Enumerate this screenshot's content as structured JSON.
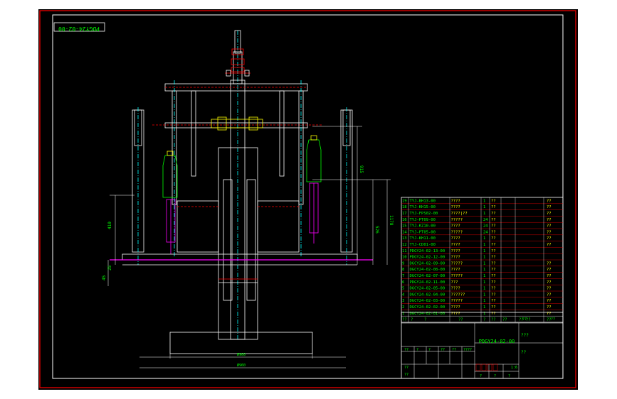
{
  "drawing": {
    "number_label": "PDGY24-02-00",
    "title_block": {
      "drawing_no": "PDGY24-02-00",
      "name_placeholder": "???",
      "material_placeholder": "??",
      "scale": "1:6",
      "header_cells": [
        "??",
        "?",
        "?",
        "??",
        "??",
        "????",
        "??",
        "??"
      ],
      "sheet_cells": [
        "?",
        "?",
        "?"
      ],
      "marks": [
        "??",
        "??"
      ]
    },
    "bom": [
      {
        "no": "19",
        "code": "TYJ-BH13-00",
        "name": "????",
        "qty": "1",
        "mat": "??",
        "note": "??"
      },
      {
        "no": "18",
        "code": "TYJ-KH15-00",
        "name": "????",
        "qty": "1",
        "mat": "??",
        "note": "??"
      },
      {
        "no": "17",
        "code": "TYJ-FPS02-00",
        "name": "????|??",
        "qty": "1",
        "mat": "??",
        "note": "??"
      },
      {
        "no": "16",
        "code": "TYJ-PT09-00",
        "name": "?????",
        "qty": "24",
        "mat": "??",
        "note": "??"
      },
      {
        "no": "15",
        "code": "TYJ-KZ10-00",
        "name": "????",
        "qty": "24",
        "mat": "??",
        "note": "??"
      },
      {
        "no": "14",
        "code": "TYJ-PT05-00",
        "name": "?????",
        "qty": "24",
        "mat": "??",
        "note": "??"
      },
      {
        "no": "13",
        "code": "TYJ-KH11-00",
        "name": "????",
        "qty": "1",
        "mat": "??",
        "note": "??"
      },
      {
        "no": "12",
        "code": "TYJ-CD01-00",
        "name": "????",
        "qty": "1",
        "mat": "??",
        "note": "??"
      },
      {
        "no": "11",
        "code": "PDGY24-02-13-00",
        "name": "????",
        "qty": "1",
        "mat": "??",
        "note": ""
      },
      {
        "no": "10",
        "code": "PDGY24-02-12-00",
        "name": "????",
        "qty": "1",
        "mat": "??",
        "note": ""
      },
      {
        "no": "9",
        "code": "DGCY24-02-09-00",
        "name": "?????",
        "qty": "1",
        "mat": "??",
        "note": "??"
      },
      {
        "no": "8",
        "code": "DGCY24-02-08-00",
        "name": "????",
        "qty": "1",
        "mat": "??",
        "note": "??"
      },
      {
        "no": "7",
        "code": "DGCY24-02-07-00",
        "name": "?????",
        "qty": "1",
        "mat": "??",
        "note": "??"
      },
      {
        "no": "6",
        "code": "PDGY24-02-11-00",
        "name": "???",
        "qty": "1",
        "mat": "??",
        "note": "??"
      },
      {
        "no": "5",
        "code": "DGCY24-02-05-00",
        "name": "????",
        "qty": "1",
        "mat": "??",
        "note": "??"
      },
      {
        "no": "4",
        "code": "DGCY24-02-04-00",
        "name": "??????",
        "qty": "1",
        "mat": "??",
        "note": "??"
      },
      {
        "no": "3",
        "code": "DGCY24-02-03-00",
        "name": "?????",
        "qty": "1",
        "mat": "??",
        "note": "??"
      },
      {
        "no": "2",
        "code": "DGCY24-02-02-00",
        "name": "????",
        "qty": "1",
        "mat": "??",
        "note": "??"
      },
      {
        "no": "1",
        "code": "DGCY24-02-01-00",
        "name": "????",
        "qty": "1",
        "mat": "??",
        "note": "??"
      }
    ],
    "bom_header": [
      "??",
      "?",
      "?",
      "??",
      "?",
      "??",
      "??",
      "?? ??",
      "??"
    ],
    "dimensions": {
      "left_height": "410",
      "left_small_1": "25",
      "left_small_2": "45",
      "right_1": "915",
      "right_2": "1178",
      "right_3": "526",
      "bottom_1": "Ø900",
      "bottom_2": "Ø960"
    },
    "colors": {
      "background": "#000000",
      "frame": "#ff0000",
      "outline": "#ffffff",
      "text": "#00ff00",
      "accent": "#ff00ff",
      "cyan": "#00ffff",
      "yellow": "#ffff00"
    }
  }
}
